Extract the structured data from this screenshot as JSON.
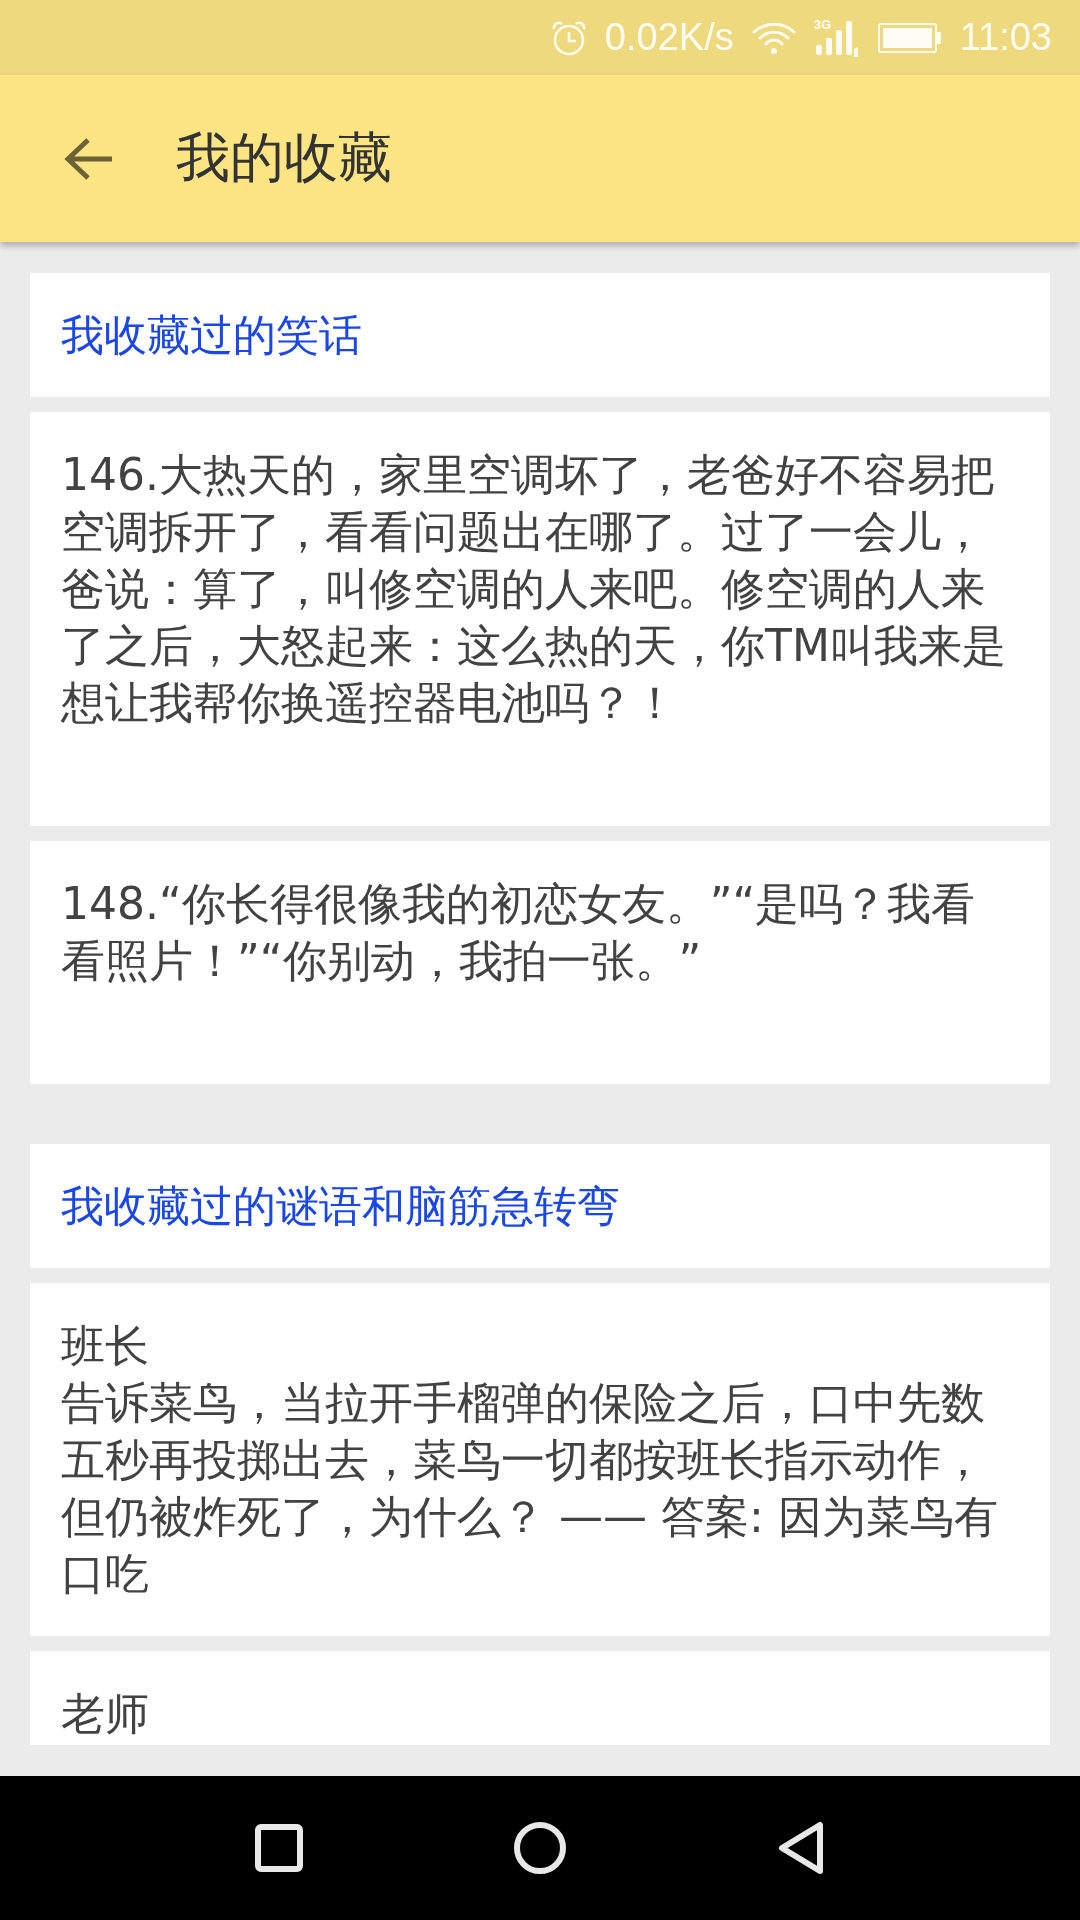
{
  "status_bar": {
    "speed": "0.02K/s",
    "network": "3G",
    "time": "11:03"
  },
  "toolbar": {
    "title": "我的收藏"
  },
  "sections": [
    {
      "kind": "joke",
      "title": "我收藏过的笑话",
      "items": [
        {
          "text": "146.大热天的，家里空调坏了，老爸好不容易把空调拆开了，看看问题出在哪了。过了一会儿，爸说：算了，叫修空调的人来吧。修空调的人来了之后，大怒起来：这么热的天，你TM叫我来是想让我帮你换遥控器电池吗？！"
        },
        {
          "text": "148.“你长得很像我的初恋女友。”“是吗？我看看照片！”“你别动，我拍一张。”"
        }
      ]
    },
    {
      "kind": "riddle",
      "title": "我收藏过的谜语和脑筋急转弯",
      "items": [
        {
          "title": "班长",
          "text": "告诉菜鸟，当拉开手榴弹的保险之后，口中先数五秒再投掷出去，菜鸟一切都按班长指示动作，但仍被炸死了，为什么？ —— 答案: 因为菜鸟有口吃"
        },
        {
          "title": "老师"
        }
      ]
    }
  ]
}
